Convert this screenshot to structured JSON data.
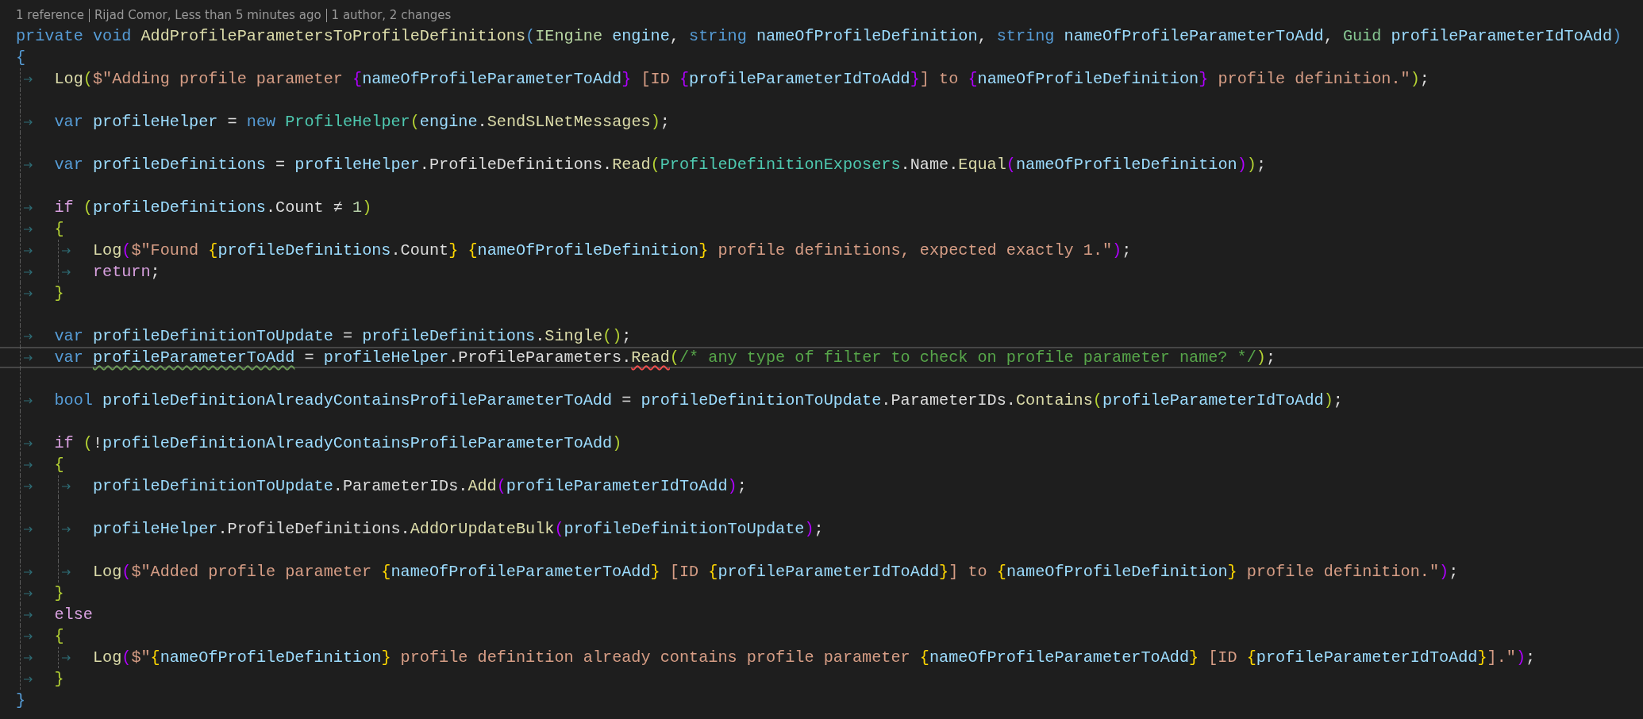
{
  "code_lens": [
    "1 reference",
    "Rijad Comor, Less than 5 minutes ago",
    "1 author, 2 changes"
  ],
  "lines": [
    {
      "kind": "code",
      "current": false,
      "tokens": [
        {
          "text": "private void ",
          "kind": "keyword"
        },
        {
          "text": "AddProfileParametersToProfileDefinitions",
          "kind": "method"
        },
        {
          "text": "(",
          "kind": "bracket",
          "color": "#569cd6"
        },
        {
          "text": "IEngine ",
          "kind": "interface"
        },
        {
          "text": "engine",
          "kind": "variable"
        },
        {
          "text": ", ",
          "kind": "plain"
        },
        {
          "text": "string ",
          "kind": "keyword"
        },
        {
          "text": "nameOfProfileDefinition",
          "kind": "variable"
        },
        {
          "text": ", ",
          "kind": "plain"
        },
        {
          "text": "string ",
          "kind": "keyword"
        },
        {
          "text": "nameOfProfileParameterToAdd",
          "kind": "variable"
        },
        {
          "text": ", ",
          "kind": "plain"
        },
        {
          "text": "Guid ",
          "kind": "struct"
        },
        {
          "text": "profileParameterIdToAdd",
          "kind": "variable"
        },
        {
          "text": ")",
          "kind": "bracket",
          "color": "#569cd6"
        }
      ]
    },
    {
      "kind": "code",
      "current": false,
      "tokens": [
        {
          "text": "{",
          "kind": "bracket",
          "color": "#569cd6"
        }
      ],
      "children": [
        {
          "kind": "code",
          "current": false,
          "tokens": [
            {
              "text": "Log",
              "kind": "method"
            },
            {
              "text": "(",
              "kind": "bracket",
              "color": "#b5d334"
            },
            {
              "text": "$\"Adding profile parameter ",
              "kind": "string"
            },
            {
              "text": "{",
              "kind": "bracket",
              "color": "#b000ff"
            },
            {
              "text": "nameOfProfileParameterToAdd",
              "kind": "variable"
            },
            {
              "text": "}",
              "kind": "bracket",
              "color": "#b000ff"
            },
            {
              "text": " [ID ",
              "kind": "string"
            },
            {
              "text": "{",
              "kind": "bracket",
              "color": "#b000ff"
            },
            {
              "text": "profileParameterIdToAdd",
              "kind": "variable"
            },
            {
              "text": "}",
              "kind": "bracket",
              "color": "#b000ff"
            },
            {
              "text": "] to ",
              "kind": "string"
            },
            {
              "text": "{",
              "kind": "bracket",
              "color": "#b000ff"
            },
            {
              "text": "nameOfProfileDefinition",
              "kind": "variable"
            },
            {
              "text": "}",
              "kind": "bracket",
              "color": "#b000ff"
            },
            {
              "text": " profile definition.\"",
              "kind": "string"
            },
            {
              "text": ")",
              "kind": "bracket",
              "color": "#b5d334"
            },
            {
              "text": ";",
              "kind": "plain"
            }
          ]
        },
        {
          "kind": "blank",
          "current": false
        },
        {
          "kind": "code",
          "current": false,
          "tokens": [
            {
              "text": "var ",
              "kind": "keyword"
            },
            {
              "text": "profileHelper",
              "kind": "variable"
            },
            {
              "text": " = ",
              "kind": "plain"
            },
            {
              "text": "new ",
              "kind": "keyword"
            },
            {
              "text": "ProfileHelper",
              "kind": "type"
            },
            {
              "text": "(",
              "kind": "bracket",
              "color": "#b5d334"
            },
            {
              "text": "engine",
              "kind": "variable"
            },
            {
              "text": ".",
              "kind": "plain"
            },
            {
              "text": "SendSLNetMessages",
              "kind": "method"
            },
            {
              "text": ")",
              "kind": "bracket",
              "color": "#b5d334"
            },
            {
              "text": ";",
              "kind": "plain"
            }
          ]
        },
        {
          "kind": "blank",
          "current": false
        },
        {
          "kind": "code",
          "current": false,
          "tokens": [
            {
              "text": "var ",
              "kind": "keyword"
            },
            {
              "text": "profileDefinitions",
              "kind": "variable"
            },
            {
              "text": " = ",
              "kind": "plain"
            },
            {
              "text": "profileHelper",
              "kind": "variable"
            },
            {
              "text": ".ProfileDefinitions.",
              "kind": "plain"
            },
            {
              "text": "Read",
              "kind": "method"
            },
            {
              "text": "(",
              "kind": "bracket",
              "color": "#b5d334"
            },
            {
              "text": "ProfileDefinitionExposers",
              "kind": "type"
            },
            {
              "text": ".Name.",
              "kind": "plain"
            },
            {
              "text": "Equal",
              "kind": "method"
            },
            {
              "text": "(",
              "kind": "bracket",
              "color": "#b000ff"
            },
            {
              "text": "nameOfProfileDefinition",
              "kind": "variable"
            },
            {
              "text": ")",
              "kind": "bracket",
              "color": "#b000ff"
            },
            {
              "text": ")",
              "kind": "bracket",
              "color": "#b5d334"
            },
            {
              "text": ";",
              "kind": "plain"
            }
          ]
        },
        {
          "kind": "blank",
          "current": false
        },
        {
          "kind": "code",
          "current": false,
          "tokens": [
            {
              "text": "if ",
              "kind": "control"
            },
            {
              "text": "(",
              "kind": "bracket",
              "color": "#b5d334"
            },
            {
              "text": "profileDefinitions",
              "kind": "variable"
            },
            {
              "text": ".Count ≠ ",
              "kind": "plain"
            },
            {
              "text": "1",
              "kind": "number"
            },
            {
              "text": ")",
              "kind": "bracket",
              "color": "#b5d334"
            }
          ]
        },
        {
          "kind": "code",
          "current": false,
          "tokens": [
            {
              "text": "{",
              "kind": "bracket",
              "color": "#b5d334"
            }
          ],
          "children": [
            {
              "kind": "code",
              "current": false,
              "tokens": [
                {
                  "text": "Log",
                  "kind": "method"
                },
                {
                  "text": "(",
                  "kind": "bracket",
                  "color": "#b000ff"
                },
                {
                  "text": "$\"Found ",
                  "kind": "string"
                },
                {
                  "text": "{",
                  "kind": "bracket",
                  "color": "#ffd700"
                },
                {
                  "text": "profileDefinitions",
                  "kind": "variable"
                },
                {
                  "text": ".Count",
                  "kind": "plain"
                },
                {
                  "text": "} ",
                  "kind": "bracket",
                  "color": "#ffd700"
                },
                {
                  "text": "{",
                  "kind": "bracket",
                  "color": "#ffd700"
                },
                {
                  "text": "nameOfProfileDefinition",
                  "kind": "variable"
                },
                {
                  "text": "}",
                  "kind": "bracket",
                  "color": "#ffd700"
                },
                {
                  "text": " profile definitions, expected exactly 1.\"",
                  "kind": "string"
                },
                {
                  "text": ")",
                  "kind": "bracket",
                  "color": "#b000ff"
                },
                {
                  "text": ";",
                  "kind": "plain"
                }
              ]
            },
            {
              "kind": "code",
              "current": false,
              "tokens": [
                {
                  "text": "return",
                  "kind": "control"
                },
                {
                  "text": ";",
                  "kind": "plain"
                }
              ]
            }
          ]
        },
        {
          "kind": "code",
          "current": false,
          "tokens": [
            {
              "text": "}",
              "kind": "bracket",
              "color": "#b5d334"
            }
          ]
        },
        {
          "kind": "blank",
          "current": false
        },
        {
          "kind": "code",
          "current": false,
          "tokens": [
            {
              "text": "var ",
              "kind": "keyword"
            },
            {
              "text": "profileDefinitionToUpdate",
              "kind": "variable"
            },
            {
              "text": " = ",
              "kind": "plain"
            },
            {
              "text": "profileDefinitions",
              "kind": "variable"
            },
            {
              "text": ".",
              "kind": "plain"
            },
            {
              "text": "Single",
              "kind": "method"
            },
            {
              "text": "(",
              "kind": "bracket",
              "color": "#b5d334"
            },
            {
              "text": ")",
              "kind": "bracket",
              "color": "#b5d334"
            },
            {
              "text": ";",
              "kind": "plain"
            }
          ]
        },
        {
          "kind": "code",
          "current": true,
          "tokens": [
            {
              "text": "var ",
              "kind": "keyword"
            },
            {
              "text": "profileParameterToAdd",
              "kind": "variable",
              "warning": true
            },
            {
              "text": " = ",
              "kind": "plain"
            },
            {
              "text": "profileHelper",
              "kind": "variable"
            },
            {
              "text": ".ProfileParameters.",
              "kind": "plain"
            },
            {
              "text": "Read",
              "kind": "method",
              "error": true
            },
            {
              "text": "(",
              "kind": "bracket",
              "color": "#b5d334"
            },
            {
              "text": "/* any type of filter to check on profile parameter name? */",
              "kind": "comment"
            },
            {
              "text": ")",
              "kind": "bracket",
              "color": "#b5d334"
            },
            {
              "text": ";",
              "kind": "plain"
            }
          ]
        },
        {
          "kind": "blank",
          "current": false
        },
        {
          "kind": "code",
          "current": false,
          "tokens": [
            {
              "text": "bool ",
              "kind": "keyword"
            },
            {
              "text": "profileDefinitionAlreadyContainsProfileParameterToAdd",
              "kind": "variable"
            },
            {
              "text": " = ",
              "kind": "plain"
            },
            {
              "text": "profileDefinitionToUpdate",
              "kind": "variable"
            },
            {
              "text": ".ParameterIDs.",
              "kind": "plain"
            },
            {
              "text": "Contains",
              "kind": "method"
            },
            {
              "text": "(",
              "kind": "bracket",
              "color": "#b5d334"
            },
            {
              "text": "profileParameterIdToAdd",
              "kind": "variable"
            },
            {
              "text": ")",
              "kind": "bracket",
              "color": "#b5d334"
            },
            {
              "text": ";",
              "kind": "plain"
            }
          ]
        },
        {
          "kind": "blank",
          "current": false
        },
        {
          "kind": "code",
          "current": false,
          "tokens": [
            {
              "text": "if ",
              "kind": "control"
            },
            {
              "text": "(",
              "kind": "bracket",
              "color": "#b5d334"
            },
            {
              "text": "!",
              "kind": "plain"
            },
            {
              "text": "profileDefinitionAlreadyContainsProfileParameterToAdd",
              "kind": "variable"
            },
            {
              "text": ")",
              "kind": "bracket",
              "color": "#b5d334"
            }
          ]
        },
        {
          "kind": "code",
          "current": false,
          "tokens": [
            {
              "text": "{",
              "kind": "bracket",
              "color": "#b5d334"
            }
          ],
          "children": [
            {
              "kind": "code",
              "current": false,
              "tokens": [
                {
                  "text": "profileDefinitionToUpdate",
                  "kind": "variable"
                },
                {
                  "text": ".ParameterIDs.",
                  "kind": "plain"
                },
                {
                  "text": "Add",
                  "kind": "method"
                },
                {
                  "text": "(",
                  "kind": "bracket",
                  "color": "#b000ff"
                },
                {
                  "text": "profileParameterIdToAdd",
                  "kind": "variable"
                },
                {
                  "text": ")",
                  "kind": "bracket",
                  "color": "#b000ff"
                },
                {
                  "text": ";",
                  "kind": "plain"
                }
              ]
            },
            {
              "kind": "blank",
              "current": false
            },
            {
              "kind": "code",
              "current": false,
              "tokens": [
                {
                  "text": "profileHelper",
                  "kind": "variable"
                },
                {
                  "text": ".ProfileDefinitions.",
                  "kind": "plain"
                },
                {
                  "text": "AddOrUpdateBulk",
                  "kind": "method"
                },
                {
                  "text": "(",
                  "kind": "bracket",
                  "color": "#b000ff"
                },
                {
                  "text": "profileDefinitionToUpdate",
                  "kind": "variable"
                },
                {
                  "text": ")",
                  "kind": "bracket",
                  "color": "#b000ff"
                },
                {
                  "text": ";",
                  "kind": "plain"
                }
              ]
            },
            {
              "kind": "blank",
              "current": false
            },
            {
              "kind": "code",
              "current": false,
              "tokens": [
                {
                  "text": "Log",
                  "kind": "method"
                },
                {
                  "text": "(",
                  "kind": "bracket",
                  "color": "#b000ff"
                },
                {
                  "text": "$\"Added profile parameter ",
                  "kind": "string"
                },
                {
                  "text": "{",
                  "kind": "bracket",
                  "color": "#ffd700"
                },
                {
                  "text": "nameOfProfileParameterToAdd",
                  "kind": "variable"
                },
                {
                  "text": "}",
                  "kind": "bracket",
                  "color": "#ffd700"
                },
                {
                  "text": " [ID ",
                  "kind": "string"
                },
                {
                  "text": "{",
                  "kind": "bracket",
                  "color": "#ffd700"
                },
                {
                  "text": "profileParameterIdToAdd",
                  "kind": "variable"
                },
                {
                  "text": "}",
                  "kind": "bracket",
                  "color": "#ffd700"
                },
                {
                  "text": "] to ",
                  "kind": "string"
                },
                {
                  "text": "{",
                  "kind": "bracket",
                  "color": "#ffd700"
                },
                {
                  "text": "nameOfProfileDefinition",
                  "kind": "variable"
                },
                {
                  "text": "}",
                  "kind": "bracket",
                  "color": "#ffd700"
                },
                {
                  "text": " profile definition.\"",
                  "kind": "string"
                },
                {
                  "text": ")",
                  "kind": "bracket",
                  "color": "#b000ff"
                },
                {
                  "text": ";",
                  "kind": "plain"
                }
              ]
            }
          ]
        },
        {
          "kind": "code",
          "current": false,
          "tokens": [
            {
              "text": "}",
              "kind": "bracket",
              "color": "#b5d334"
            }
          ]
        },
        {
          "kind": "code",
          "current": false,
          "tokens": [
            {
              "text": "else",
              "kind": "control"
            }
          ]
        },
        {
          "kind": "code",
          "current": false,
          "tokens": [
            {
              "text": "{",
              "kind": "bracket",
              "color": "#b5d334"
            }
          ],
          "children": [
            {
              "kind": "code",
              "current": false,
              "tokens": [
                {
                  "text": "Log",
                  "kind": "method"
                },
                {
                  "text": "(",
                  "kind": "bracket",
                  "color": "#b000ff"
                },
                {
                  "text": "$\"",
                  "kind": "string"
                },
                {
                  "text": "{",
                  "kind": "bracket",
                  "color": "#ffd700"
                },
                {
                  "text": "nameOfProfileDefinition",
                  "kind": "variable"
                },
                {
                  "text": "}",
                  "kind": "bracket",
                  "color": "#ffd700"
                },
                {
                  "text": " profile definition already contains profile parameter ",
                  "kind": "string"
                },
                {
                  "text": "{",
                  "kind": "bracket",
                  "color": "#ffd700"
                },
                {
                  "text": "nameOfProfileParameterToAdd",
                  "kind": "variable"
                },
                {
                  "text": "}",
                  "kind": "bracket",
                  "color": "#ffd700"
                },
                {
                  "text": " [ID ",
                  "kind": "string"
                },
                {
                  "text": "{",
                  "kind": "bracket",
                  "color": "#ffd700"
                },
                {
                  "text": "profileParameterIdToAdd",
                  "kind": "variable"
                },
                {
                  "text": "}",
                  "kind": "bracket",
                  "color": "#ffd700"
                },
                {
                  "text": "].\"",
                  "kind": "string"
                },
                {
                  "text": ")",
                  "kind": "bracket",
                  "color": "#b000ff"
                },
                {
                  "text": ";",
                  "kind": "plain"
                }
              ]
            }
          ]
        },
        {
          "kind": "code",
          "current": false,
          "tokens": [
            {
              "text": "}",
              "kind": "bracket",
              "color": "#b5d334"
            }
          ]
        }
      ]
    },
    {
      "kind": "code",
      "current": false,
      "tokens": [
        {
          "text": "}",
          "kind": "bracket",
          "color": "#569cd6"
        }
      ]
    }
  ]
}
